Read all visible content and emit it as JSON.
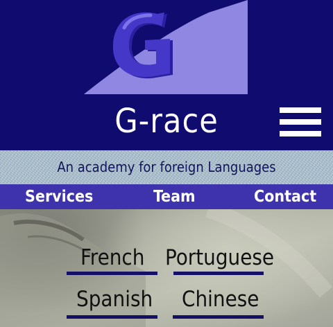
{
  "header": {
    "logo_letter": "G",
    "site_title": "G-race",
    "menu_icon": "hamburger-menu-icon"
  },
  "tagline": "An academy for foreign Languages",
  "nav": {
    "items": [
      {
        "label": "Services"
      },
      {
        "label": "Team"
      },
      {
        "label": "Contact"
      }
    ]
  },
  "languages": [
    {
      "label": "French"
    },
    {
      "label": "Portuguese"
    },
    {
      "label": "Spanish"
    },
    {
      "label": "Chinese"
    }
  ],
  "colors": {
    "header_bg": "#0f0b6f",
    "nav_bg": "#3f33ad",
    "logo_shape": "#8f87e2",
    "underline": "#141066"
  }
}
